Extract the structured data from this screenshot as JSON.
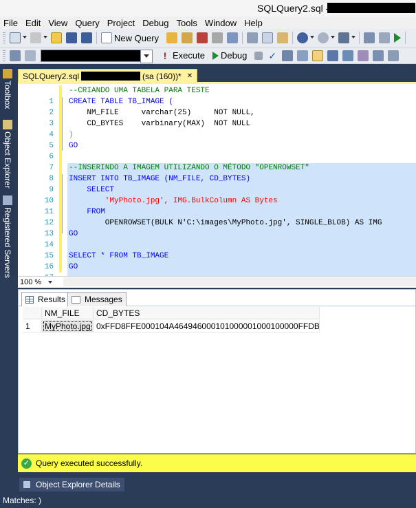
{
  "window": {
    "title": "SQLQuery2.sql -"
  },
  "menu": [
    "File",
    "Edit",
    "View",
    "Query",
    "Project",
    "Debug",
    "Tools",
    "Window",
    "Help"
  ],
  "toolbar1": {
    "new_query": "New Query"
  },
  "toolbar2": {
    "execute": "Execute",
    "debug": "Debug"
  },
  "sidebar": [
    "Toolbox",
    "Object Explorer",
    "Registered Servers"
  ],
  "doc_tab": {
    "name": "SQLQuery2.sql",
    "user": "(sa (160))*"
  },
  "editor": {
    "line_numbers": [
      "1",
      "2",
      "3",
      "4",
      "5",
      "6",
      "7",
      "8",
      "9",
      "10",
      "11",
      "12",
      "13",
      "14",
      "15",
      "16",
      "17"
    ],
    "lines": [
      "--CRIANDO UMA TABELA PARA TESTE",
      "CREATE TABLE TB_IMAGE (",
      "    NM_FILE     varchar(25)     NOT NULL,",
      "    CD_BYTES    varbinary(MAX)  NOT NULL",
      ")",
      "GO",
      "",
      "--INSERINDO A IMAGEM UTILIZANDO O MÉTODO \"OPENROWSET\"",
      "INSERT INTO TB_IMAGE (NM_FILE, CD_BYTES)",
      "    SELECT",
      "        'MyPhoto.jpg', IMG.BulkColumn AS Bytes",
      "    FROM",
      "        OPENROWSET(BULK N'C:\\images\\MyPhoto.jpg', SINGLE_BLOB) AS IMG",
      "GO",
      "",
      "SELECT * FROM TB_IMAGE",
      "GO"
    ]
  },
  "zoom": "100 %",
  "results": {
    "tabs": [
      "Results",
      "Messages"
    ],
    "columns": [
      "NM_FILE",
      "CD_BYTES"
    ],
    "rows": [
      {
        "num": "1",
        "nm_file": "MyPhoto.jpg",
        "cd_bytes": "0xFFD8FFE000104A464946000101000001000100000FFDB00..."
      }
    ]
  },
  "status": {
    "message": "Query executed successfully."
  },
  "bottom": {
    "panel": "Object Explorer Details",
    "matches": "Matches: )"
  }
}
